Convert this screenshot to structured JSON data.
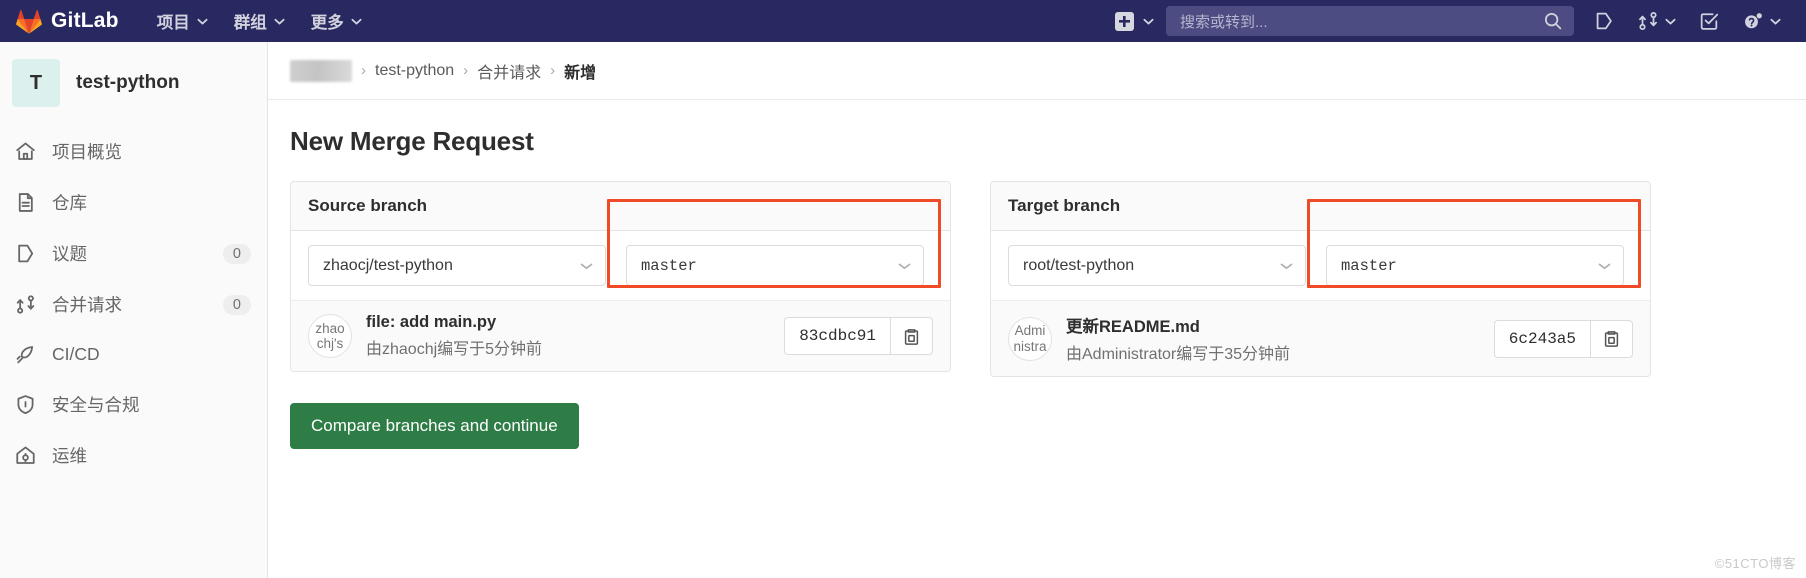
{
  "topnav": {
    "brand": "GitLab",
    "brand_icon": "gitlab-tanuki-logo",
    "links": [
      {
        "label": "项目",
        "icon": "chevron-down-icon"
      },
      {
        "label": "群组",
        "icon": "chevron-down-icon"
      },
      {
        "label": "更多",
        "icon": "chevron-down-icon"
      }
    ],
    "create_new": {
      "icon": "plus-square-icon",
      "chevron": "chevron-down-icon"
    },
    "search": {
      "placeholder": "搜索或转到...",
      "icon": "search-icon"
    },
    "icons": [
      {
        "name": "issues-icon"
      },
      {
        "name": "merge-request-icon",
        "chevron": "chevron-down-icon"
      },
      {
        "name": "todos-checkbox-icon"
      },
      {
        "name": "help-question-icon",
        "chevron": "chevron-down-icon"
      }
    ]
  },
  "sidebar": {
    "project": {
      "initial": "T",
      "name": "test-python"
    },
    "items": [
      {
        "label": "项目概览",
        "icon": "home-icon",
        "badge": ""
      },
      {
        "label": "仓库",
        "icon": "document-icon",
        "badge": ""
      },
      {
        "label": "议题",
        "icon": "issues-icon",
        "badge": "0"
      },
      {
        "label": "合并请求",
        "icon": "merge-request-icon",
        "badge": "0"
      },
      {
        "label": "CI/CD",
        "icon": "rocket-icon",
        "badge": ""
      },
      {
        "label": "安全与合规",
        "icon": "shield-icon",
        "badge": ""
      },
      {
        "label": "运维",
        "icon": "cog-cloud-icon",
        "badge": ""
      }
    ]
  },
  "breadcrumb": {
    "redacted": "",
    "items": [
      "test-python",
      "合并请求"
    ],
    "current": "新增",
    "separator": "›"
  },
  "page": {
    "title": "New Merge Request",
    "compare_button": "Compare branches and continue"
  },
  "source": {
    "heading": "Source branch",
    "project_select": "zhaocj/test-python",
    "branch_select": "master",
    "commit": {
      "avatar_line1": "zhao",
      "avatar_line2": "chj's",
      "title": "file: add main.py",
      "meta": "由zhaochj编写于5分钟前",
      "sha": "83cdbc91",
      "copy_icon": "copy-to-clipboard-icon"
    }
  },
  "target": {
    "heading": "Target branch",
    "project_select": "root/test-python",
    "branch_select": "master",
    "commit": {
      "avatar_line1": "Admi",
      "avatar_line2": "nistra",
      "title": "更新README.md",
      "meta": "由Administrator编写于35分钟前",
      "sha": "6c243a5",
      "copy_icon": "copy-to-clipboard-icon"
    }
  },
  "annotations": {
    "highlight_color": "#f04a26",
    "boxes": [
      {
        "name": "source-branch-highlight"
      },
      {
        "name": "target-branch-highlight"
      }
    ]
  },
  "watermark": "©51CTO博客"
}
